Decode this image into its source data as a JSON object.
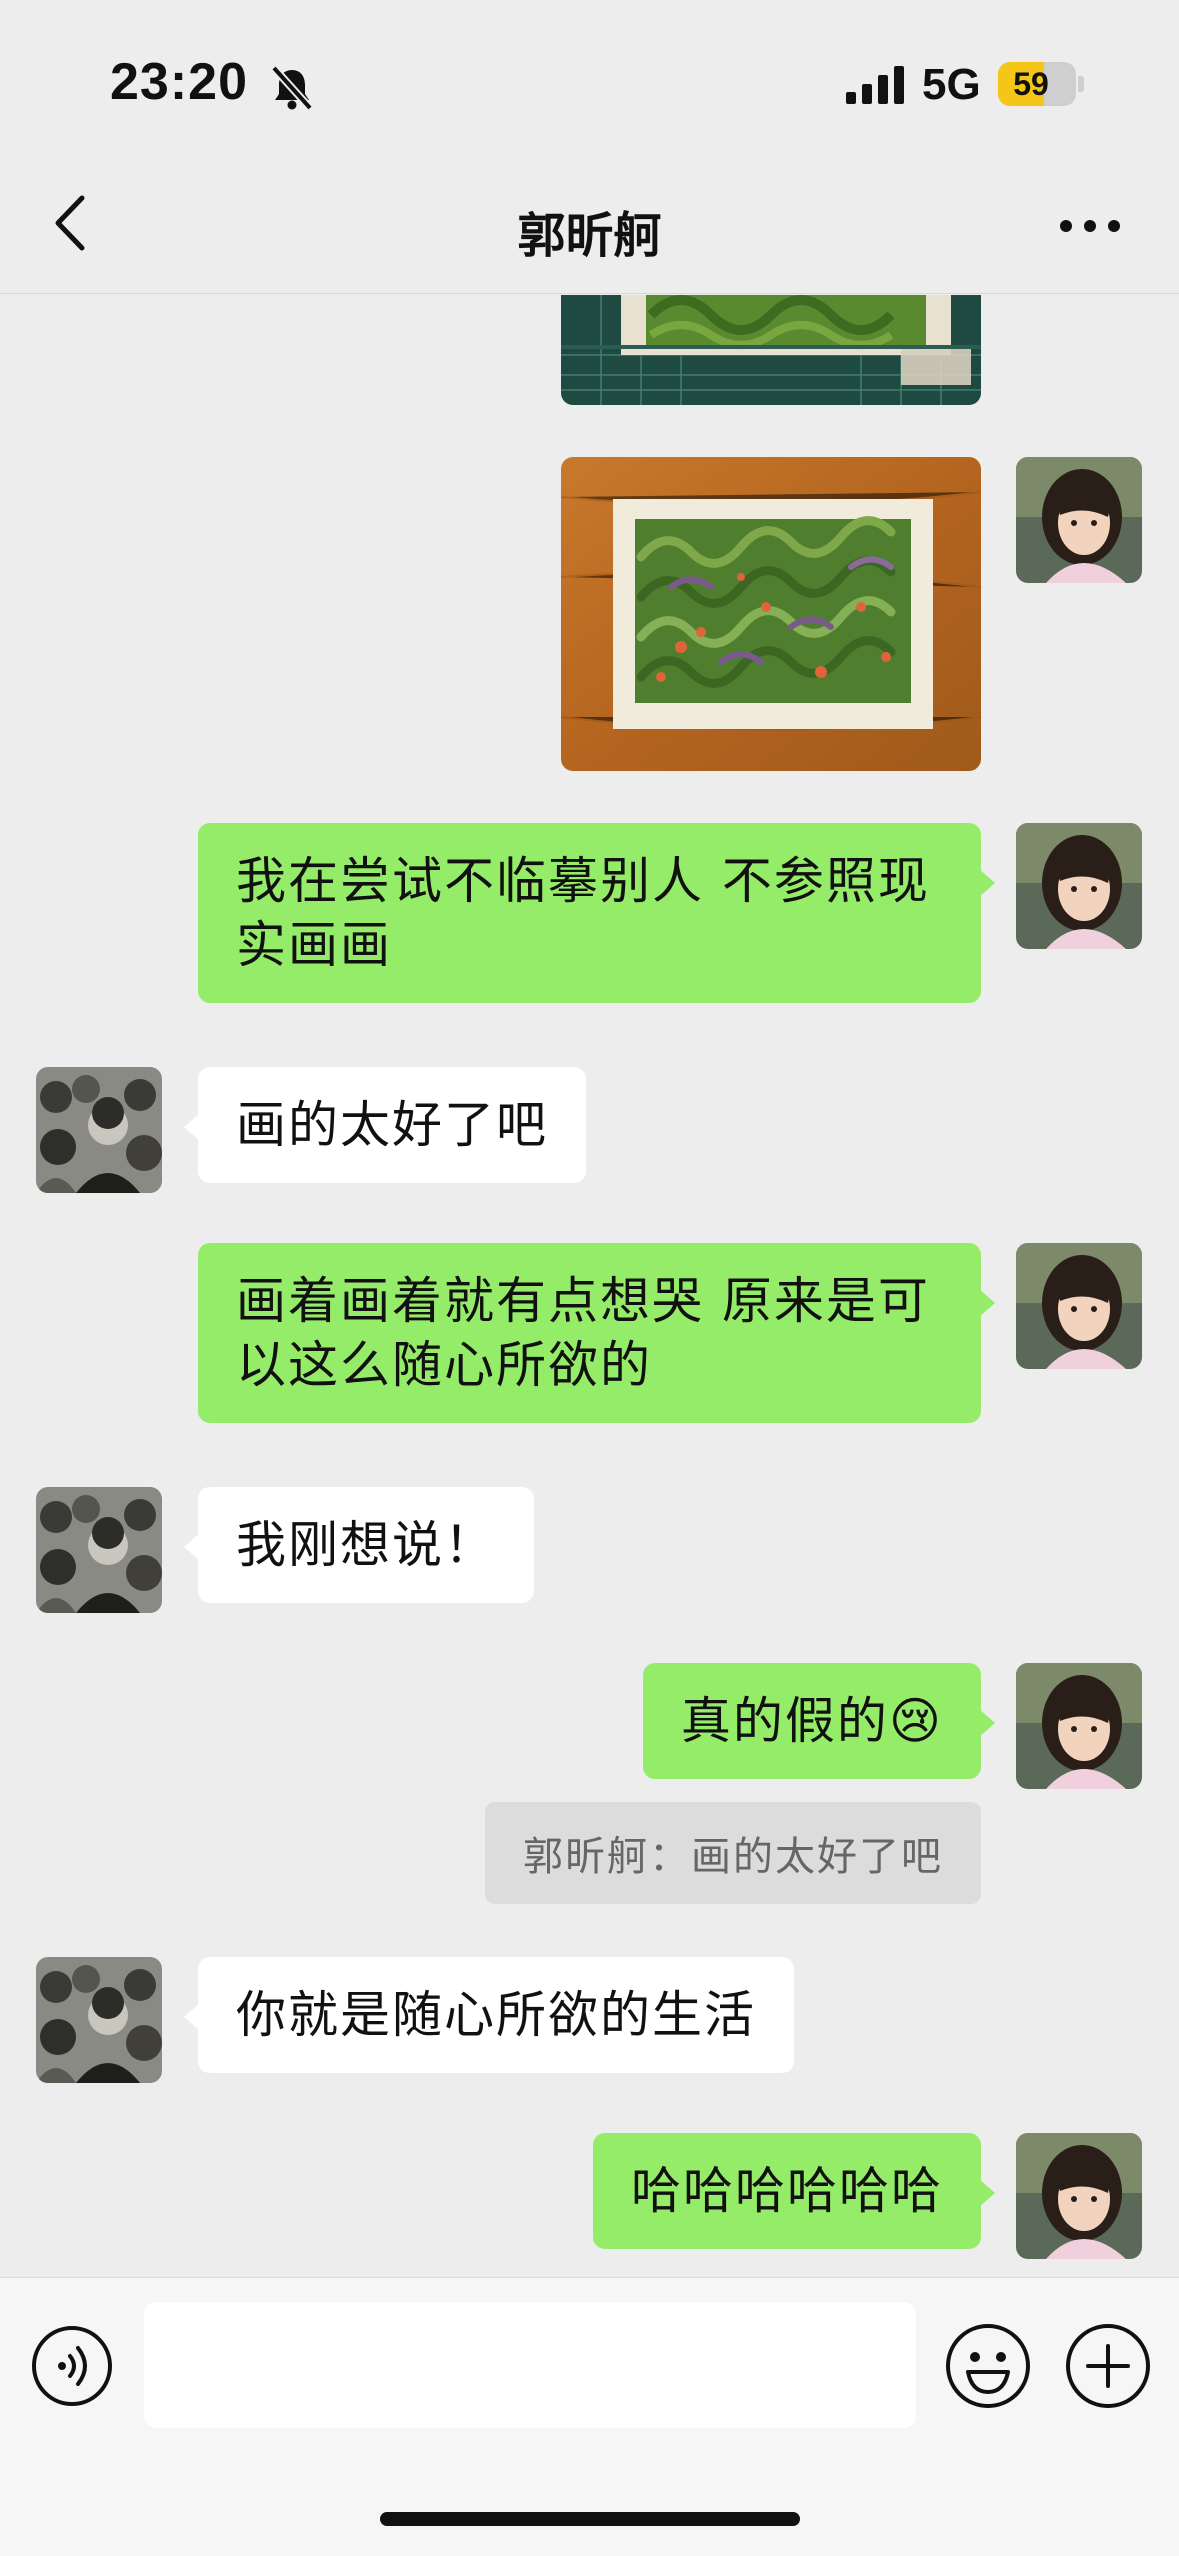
{
  "status_bar": {
    "time": "23:20",
    "network": "5G",
    "battery_level": "59",
    "battery_fraction": 0.59,
    "icons": [
      "bell-muted-icon",
      "signal-bars-icon"
    ]
  },
  "nav": {
    "title": "郭昕舸",
    "back_icon": "chevron-left-icon",
    "more_icon": "ellipsis-icon"
  },
  "messages": [
    {
      "sender": "me",
      "type": "image",
      "content": "painting-on-cutting-mat"
    },
    {
      "sender": "me",
      "type": "image",
      "content": "painting-on-wood-table"
    },
    {
      "sender": "me",
      "type": "text",
      "lines": [
        "我在尝试不临摹别人 不参照现",
        "实画画"
      ]
    },
    {
      "sender": "them",
      "type": "text",
      "lines": [
        "画的太好了吧"
      ]
    },
    {
      "sender": "me",
      "type": "text",
      "lines": [
        "画着画着就有点想哭 原来是可",
        "以这么随心所欲的"
      ]
    },
    {
      "sender": "them",
      "type": "text",
      "lines": [
        "我刚想说！"
      ]
    },
    {
      "sender": "me",
      "type": "text",
      "lines": [
        "真的假的"
      ],
      "emoji": "😢"
    },
    {
      "sender": "me",
      "type": "quote",
      "text": "郭昕舸：画的太好了吧"
    },
    {
      "sender": "them",
      "type": "text",
      "lines": [
        "你就是随心所欲的生活"
      ]
    },
    {
      "sender": "me",
      "type": "text",
      "lines": [
        "哈哈哈哈哈哈"
      ]
    }
  ],
  "input_bar": {
    "placeholder": "",
    "icons": [
      "voice-icon",
      "emoji-icon",
      "plus-icon"
    ]
  },
  "colors": {
    "background": "#ededed",
    "my_bubble": "#95ec69",
    "their_bubble": "#ffffff",
    "battery": "#f5c518"
  }
}
